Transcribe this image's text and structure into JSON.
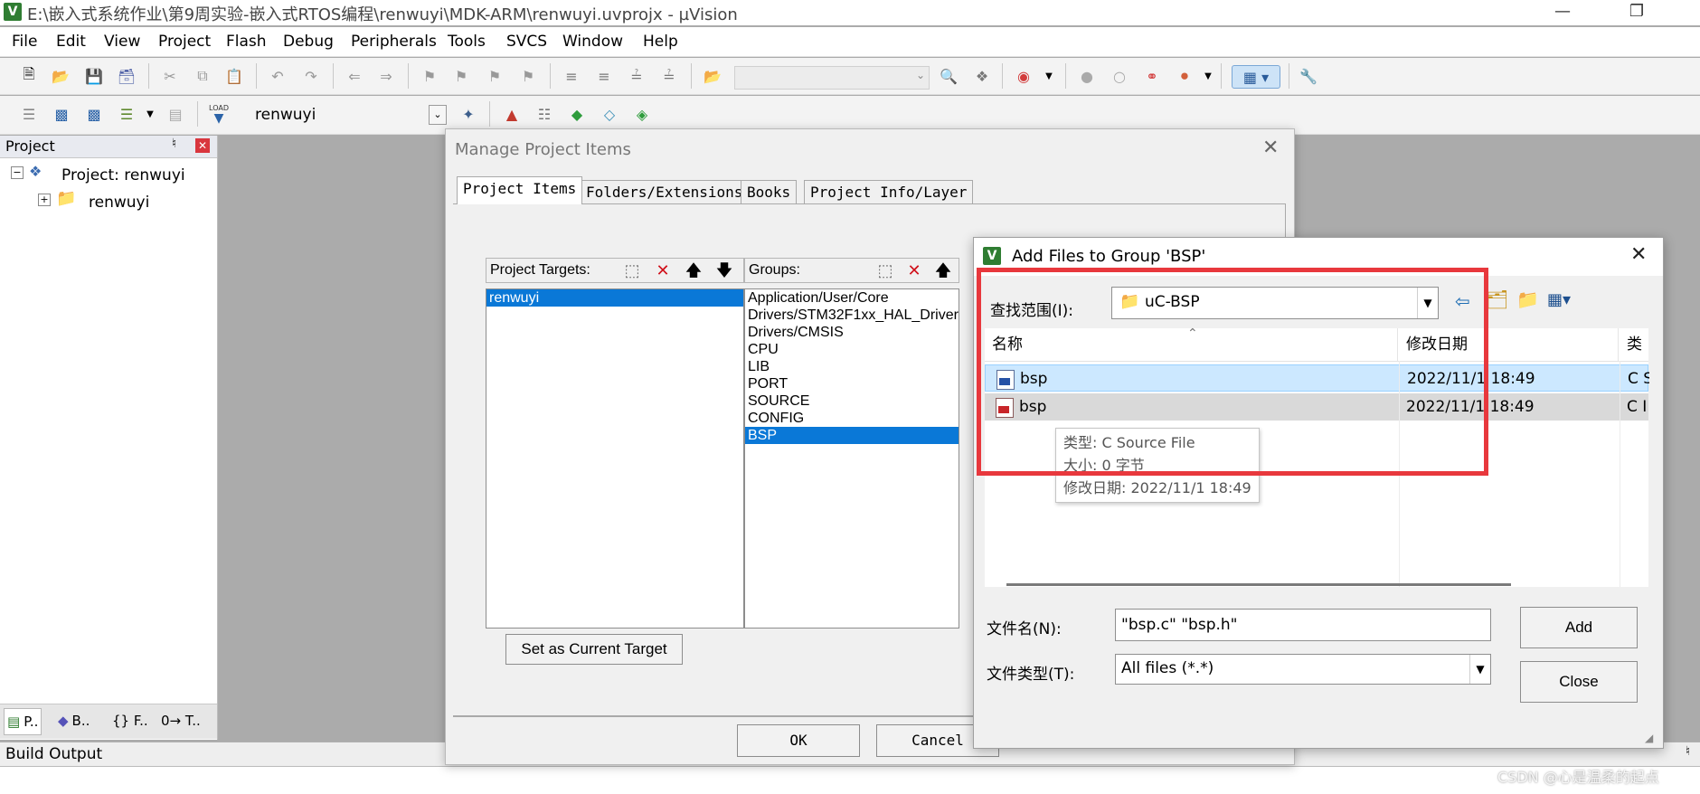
{
  "window": {
    "title": "E:\\嵌入式系统作业\\第9周实验-嵌入式RTOS编程\\renwuyi\\MDK-ARM\\renwuyi.uvprojx - µVision",
    "app_icon": "V"
  },
  "menu": [
    "File",
    "Edit",
    "View",
    "Project",
    "Flash",
    "Debug",
    "Peripherals",
    "Tools",
    "SVCS",
    "Window",
    "Help"
  ],
  "toolbar2": {
    "target": "renwuyi",
    "load_label": "LOAD"
  },
  "project_panel": {
    "title": "Project",
    "root": "Project: renwuyi",
    "child": "renwuyi",
    "tabs": [
      "P..",
      "B..",
      "{} F..",
      "0→ T.."
    ]
  },
  "build_output": {
    "title": "Build Output"
  },
  "manage_dialog": {
    "title": "Manage Project Items",
    "tabs": [
      "Project Items",
      "Folders/Extensions",
      "Books",
      "Project Info/Layer"
    ],
    "targets_label": "Project Targets:",
    "targets": [
      "renwuyi"
    ],
    "groups_label": "Groups:",
    "groups": [
      "Application/User/Core",
      "Drivers/STM32F1xx_HAL_Driver",
      "Drivers/CMSIS",
      "CPU",
      "LIB",
      "PORT",
      "SOURCE",
      "CONFIG",
      "BSP"
    ],
    "selected_group": "BSP",
    "set_current_target": "Set as Current Target",
    "ok": "OK",
    "cancel": "Cancel"
  },
  "add_files_dialog": {
    "title": "Add Files to Group 'BSP'",
    "look_in_label": "查找范围(I):",
    "look_in_value": "uC-BSP",
    "columns": [
      "名称",
      "修改日期",
      "类"
    ],
    "files": [
      {
        "name": "bsp",
        "date": "2022/11/1 18:49",
        "type": "C S"
      },
      {
        "name": "bsp",
        "date": "2022/11/1 18:49",
        "type": "C I"
      }
    ],
    "tooltip": [
      "类型: C Source File",
      "大小: 0 字节",
      "修改日期: 2022/11/1 18:49"
    ],
    "filename_label": "文件名(N):",
    "filename_value": "\"bsp.c\" \"bsp.h\"",
    "filetype_label": "文件类型(T):",
    "filetype_value": "All files (*.*)",
    "add": "Add",
    "close": "Close"
  },
  "watermark": "CSDN @心是温柔的起点",
  "colors": {
    "selection": "#0a78d7",
    "highlight_box": "#e8383d",
    "row_hover": "#cce8ff"
  }
}
